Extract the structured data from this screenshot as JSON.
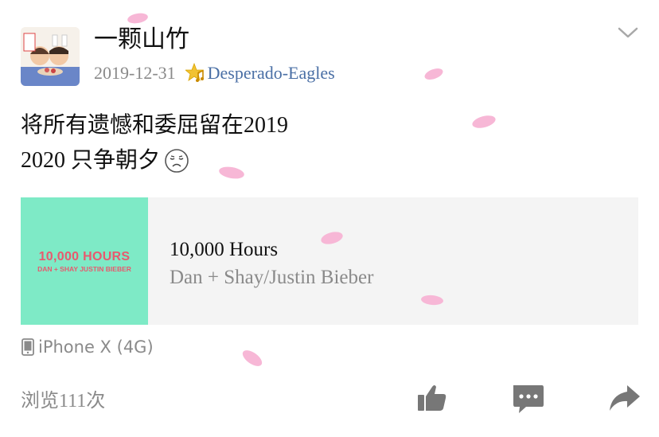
{
  "header": {
    "username": "一颗山竹",
    "date": "2019-12-31",
    "source": "Desperado-Eagles"
  },
  "post": {
    "line1": "将所有遗憾和委屈留在2019",
    "line2": "2020 只争朝夕"
  },
  "music": {
    "album_title": "10,000 HOURS",
    "album_subtitle": "DAN + SHAY JUSTIN BIEBER",
    "song_title": "10,000 Hours",
    "artist": "Dan + Shay/Justin Bieber"
  },
  "device": {
    "label": "iPhone X (4G)"
  },
  "footer": {
    "views": "浏览111次"
  },
  "icons": {
    "menu": "chevron-down-icon",
    "badge": "star-icon",
    "device": "phone-icon",
    "like": "thumbs-up-icon",
    "comment": "comment-icon",
    "share": "share-icon"
  },
  "colors": {
    "source_link": "#4a6fa5",
    "album_bg": "#7eeac6",
    "album_text": "#e8596e",
    "muted": "#8a8a8a",
    "card_bg": "#f4f4f4",
    "icon_gray": "#777777",
    "petal": "#f7b7d6"
  }
}
